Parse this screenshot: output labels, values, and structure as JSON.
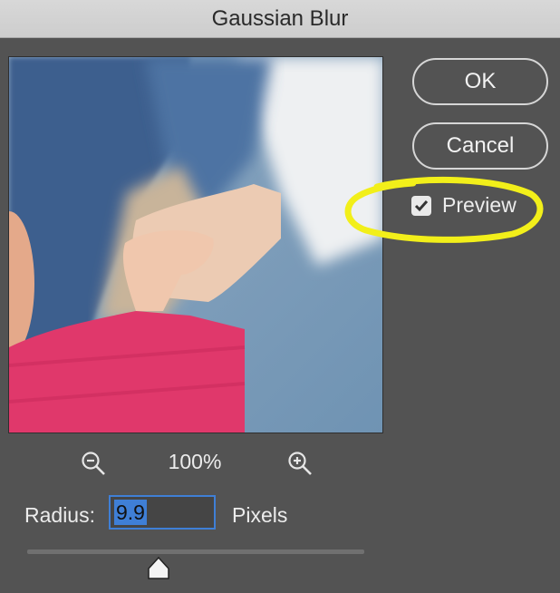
{
  "dialog": {
    "title": "Gaussian Blur"
  },
  "buttons": {
    "ok_label": "OK",
    "cancel_label": "Cancel"
  },
  "preview_toggle": {
    "label": "Preview",
    "checked": true
  },
  "zoom": {
    "level": "100%"
  },
  "radius": {
    "label": "Radius:",
    "value": "9.9",
    "unit": "Pixels"
  },
  "slider": {
    "position_fraction": 0.39
  },
  "colors": {
    "dialog_bg": "#535353",
    "titlebar_bg": "#d2d2d2",
    "accent_selection": "#3f7fd6",
    "annotation_highlight": "#f2ef1a"
  },
  "icons": {
    "zoom_out": "zoom-out-icon",
    "zoom_in": "zoom-in-icon",
    "checkmark": "checkmark-icon"
  }
}
